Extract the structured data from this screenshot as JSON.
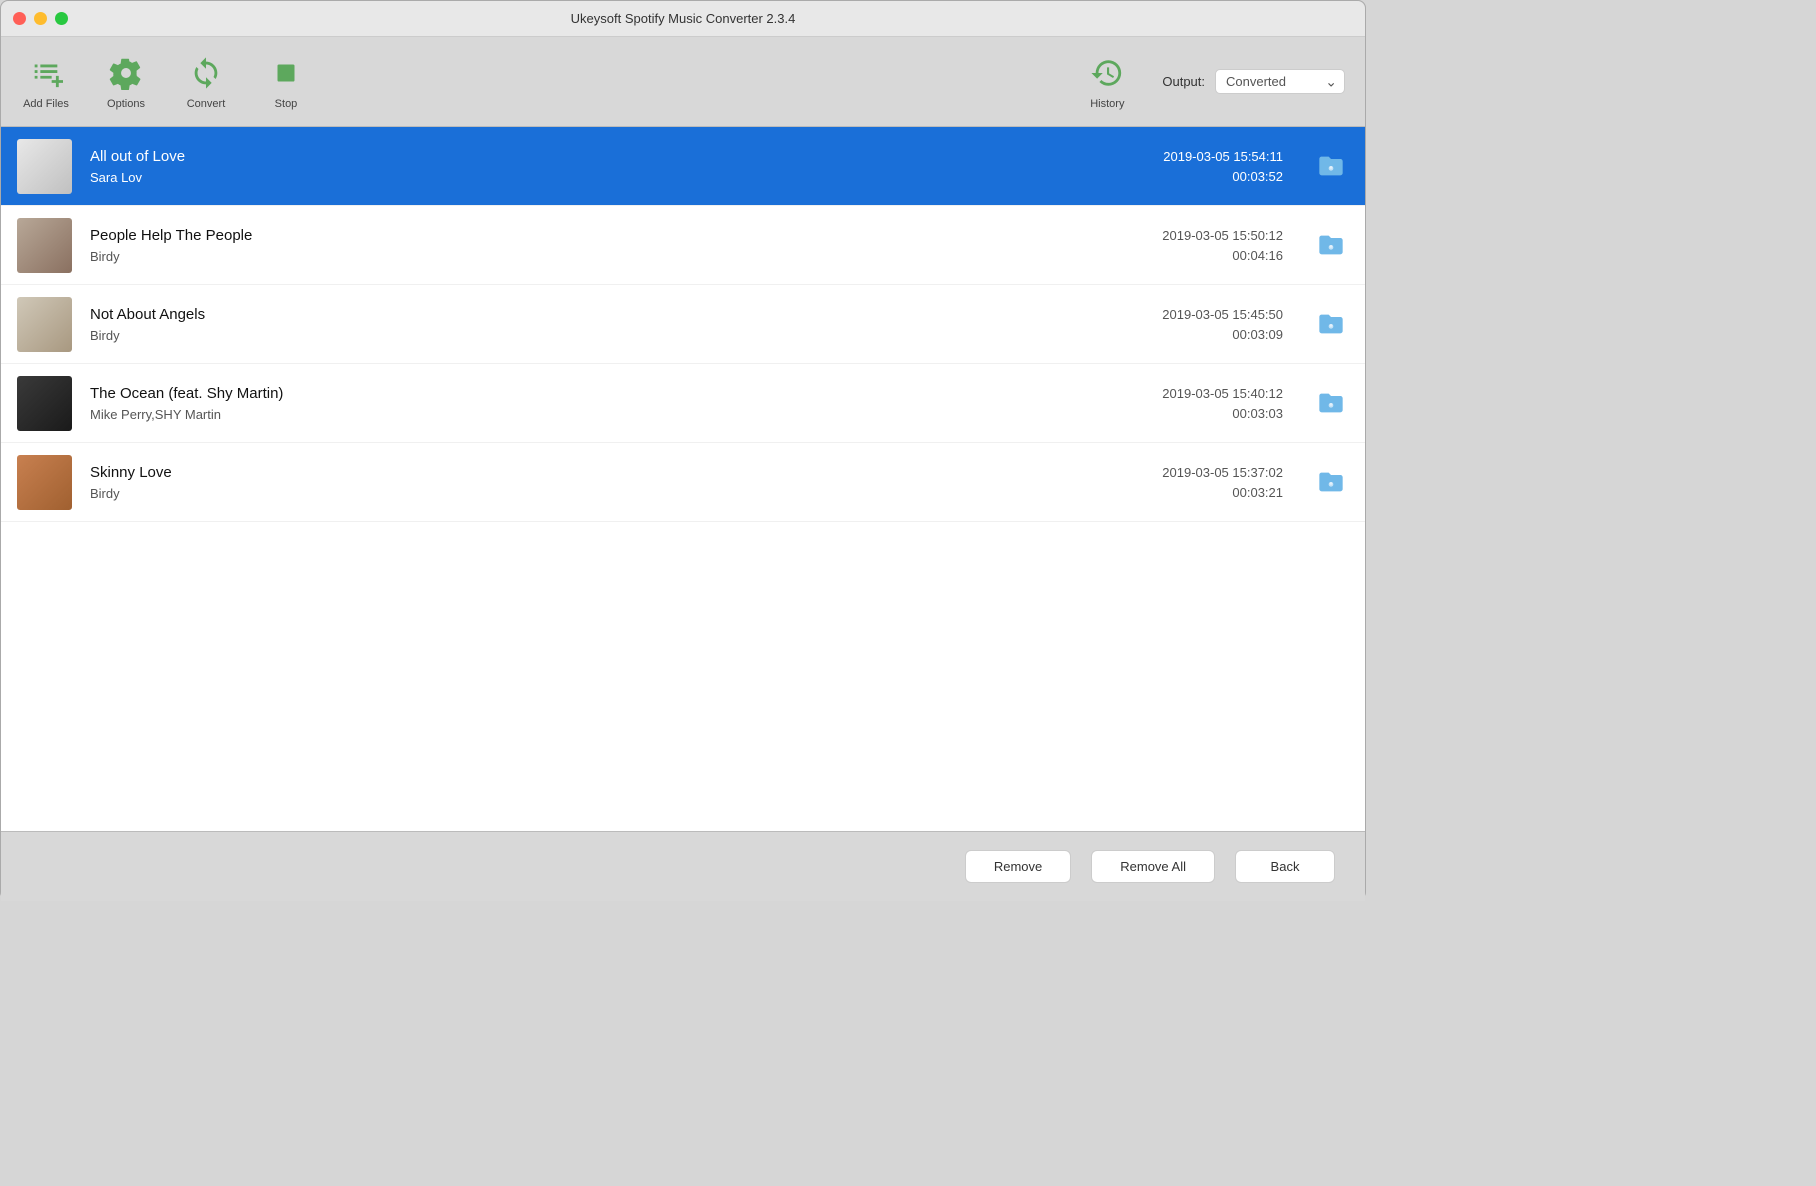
{
  "window": {
    "title": "Ukeysoft Spotify Music Converter 2.3.4"
  },
  "toolbar": {
    "add_files_label": "Add Files",
    "options_label": "Options",
    "convert_label": "Convert",
    "stop_label": "Stop",
    "history_label": "History",
    "output_label": "Output:",
    "output_value": "Converted"
  },
  "tracks": [
    {
      "title": "All out of Love",
      "artist": "Sara Lov",
      "datetime": "2019-03-05 15:54:11",
      "duration": "00:03:52",
      "selected": true,
      "art_class": "art-sara"
    },
    {
      "title": "People Help The People",
      "artist": "Birdy",
      "datetime": "2019-03-05 15:50:12",
      "duration": "00:04:16",
      "selected": false,
      "art_class": "art-birdy1"
    },
    {
      "title": "Not About Angels",
      "artist": "Birdy",
      "datetime": "2019-03-05 15:45:50",
      "duration": "00:03:09",
      "selected": false,
      "art_class": "art-birdy2"
    },
    {
      "title": "The Ocean (feat. Shy Martin)",
      "artist": "Mike Perry,SHY Martin",
      "datetime": "2019-03-05 15:40:12",
      "duration": "00:03:03",
      "selected": false,
      "art_class": "art-ocean"
    },
    {
      "title": "Skinny Love",
      "artist": "Birdy",
      "datetime": "2019-03-05 15:37:02",
      "duration": "00:03:21",
      "selected": false,
      "art_class": "art-skinny"
    }
  ],
  "buttons": {
    "remove_label": "Remove",
    "remove_all_label": "Remove All",
    "back_label": "Back"
  }
}
